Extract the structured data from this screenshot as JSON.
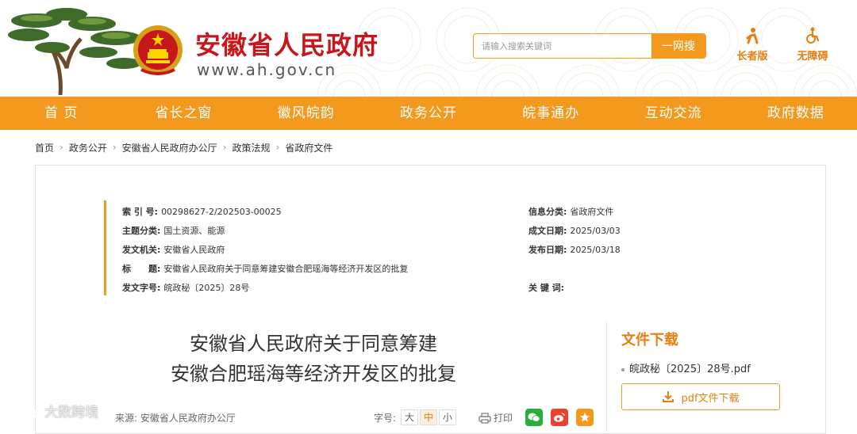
{
  "header": {
    "site_title": "安徽省人民政府",
    "site_url": "www.ah.gov.cn",
    "search_placeholder": "请输入搜索关键词",
    "search_button": "一网搜",
    "elder_mode": "长者版",
    "accessibility": "无障碍",
    "accent_color": "#f39a1e",
    "title_color": "#c8161d"
  },
  "nav": {
    "items": [
      "首 页",
      "省长之窗",
      "徽风皖韵",
      "政务公开",
      "皖事通办",
      "互动交流",
      "政府数据"
    ]
  },
  "breadcrumb": {
    "items": [
      "首页",
      "政务公开",
      "安徽省人民政府办公厅",
      "政策法规",
      "省政府文件"
    ]
  },
  "info": {
    "index_label": "索 引 号:",
    "index_value": "00298627-2/202503-00025",
    "category_label": "信息分类:",
    "category_value": "省政府文件",
    "topic_label": "主题分类:",
    "topic_value": "国土资源、能源",
    "created_label": "成文日期:",
    "created_value": "2025/03/03",
    "issuer_label": "发文机关:",
    "issuer_value": "安徽省人民政府",
    "published_label": "发布日期:",
    "published_value": "2025/03/18",
    "title_label": "标　　题:",
    "title_value": "安徽省人民政府关于同意筹建安徽合肥瑶海等经济开发区的批复",
    "docno_label": "发文字号:",
    "docno_value": "皖政秘〔2025〕28号",
    "keywords_label": "关 键 词:",
    "keywords_value": ""
  },
  "document": {
    "title_line1": "安徽省人民政府关于同意筹建",
    "title_line2": "安徽合肥瑶海等经济开发区的批复",
    "source": "来源:  安徽省人民政府办公厅",
    "fontsize_label": "字号:",
    "fontsize_large": "大",
    "fontsize_medium": "中",
    "fontsize_small": "小",
    "print_label": "打印"
  },
  "download": {
    "title": "文件下载",
    "file_name": "皖政秘〔2025〕28号.pdf",
    "button_label": "pdf文件下载"
  },
  "watermark": {
    "text": "大数跨境"
  }
}
